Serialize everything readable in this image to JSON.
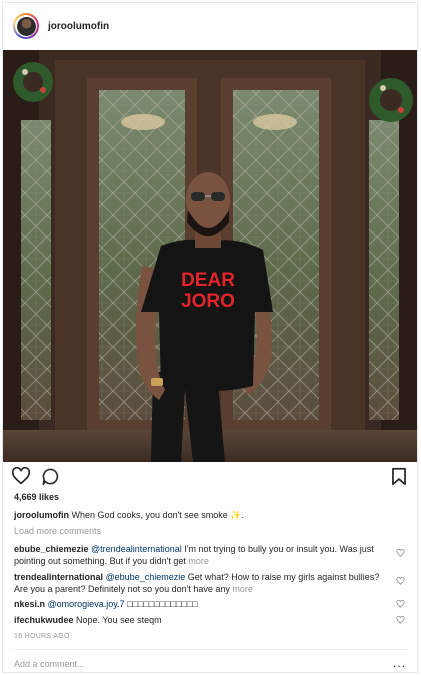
{
  "post": {
    "username": "joroolumofin",
    "likes": "4,669 likes",
    "caption": {
      "user": "joroolumofin",
      "text": "When God cooks, you don't see smoke ✨."
    },
    "load_more": "Load more comments",
    "comments": [
      {
        "user": "ebube_chiemezie",
        "mention": "@trendealinternational",
        "text": "I'm not trying to bully you or insult you. Was just pointing out something. But if you didn't get",
        "more": "more"
      },
      {
        "user": "trendealinternational",
        "mention": "@ebube_chiemezie",
        "text": "Get what? How to raise my girls against bullies? Are you a parent? Definitely not so you don't have any",
        "more": "more"
      },
      {
        "user": "nkesi.n",
        "mention": "@omorogieva.joy.7",
        "text": "□□□□□□□□□□□□□",
        "more": ""
      },
      {
        "user": "ifechukwudee",
        "mention": "",
        "text": "Nope. You see steqm",
        "more": ""
      }
    ],
    "timestamp": "16 HOURS AGO",
    "add_comment_placeholder": "Add a comment...",
    "more_options": "..."
  },
  "photo": {
    "shirt_text_line1": "DEAR",
    "shirt_text_line2": "JORO"
  },
  "colors": {
    "text": "#262626",
    "muted": "#999999",
    "mention": "#003569",
    "border": "#e6e6e6",
    "shirt_print": "#e3252b"
  },
  "icons": [
    "heart-icon",
    "comment-icon",
    "bookmark-icon",
    "small-heart-icon"
  ]
}
